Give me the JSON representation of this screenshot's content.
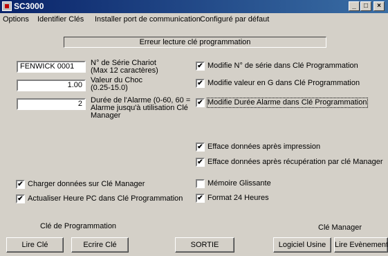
{
  "window": {
    "title": "SC3000"
  },
  "titlebar_buttons": {
    "minimize": "_",
    "maximize": "□",
    "close": "×"
  },
  "menu": [
    "Options",
    "Identifier Clés",
    "Installer port de communication",
    "Configuré par défaut"
  ],
  "status_banner": "Erreur lecture clé programmation",
  "fields": {
    "serial": {
      "value": "FENWICK 0001",
      "label": "N° de Série Chariot",
      "sublabel": "(Max 12 caractères)"
    },
    "shock": {
      "value": "1.00",
      "label": "Valeur du Choc",
      "sublabel": "(0.25-15.0)"
    },
    "alarm": {
      "value": "2",
      "label_lines": [
        "Durée de l'Alarme (0-60, 60 =",
        "Alarme jusqu'à utilisation Clé",
        "Manager"
      ]
    }
  },
  "checkboxes": {
    "modify_serial": {
      "label": "Modifie N° de série dans Clé Programmation",
      "checked": true
    },
    "modify_g": {
      "label": "Modifie valeur en G dans Clé Programmation",
      "checked": true
    },
    "modify_alarm": {
      "label": "Modifie Durée Alarme dans Clé Programmation",
      "checked": true
    },
    "erase_after_print": {
      "label": "Efface données après impression",
      "checked": true
    },
    "erase_after_manager": {
      "label": "Efface données après récupération par clé Manager",
      "checked": true
    },
    "load_manager": {
      "label": "Charger données sur Clé Manager",
      "checked": true
    },
    "update_time": {
      "label": "Actualiser Heure PC dans Clé Programmation",
      "checked": true
    },
    "sliding_memory": {
      "label": "Mémoire Glissante",
      "checked": false
    },
    "format24": {
      "label": "Format 24 Heures",
      "checked": true
    }
  },
  "sections": {
    "programming_key": "Clé de Programmation",
    "manager_key": "Clé Manager"
  },
  "buttons": {
    "read_key": "Lire Clé",
    "write_key": "Ecrire Clé",
    "exit": "SORTIE",
    "factory_software": "Logiciel Usine",
    "read_events": "Lire Evènements"
  }
}
